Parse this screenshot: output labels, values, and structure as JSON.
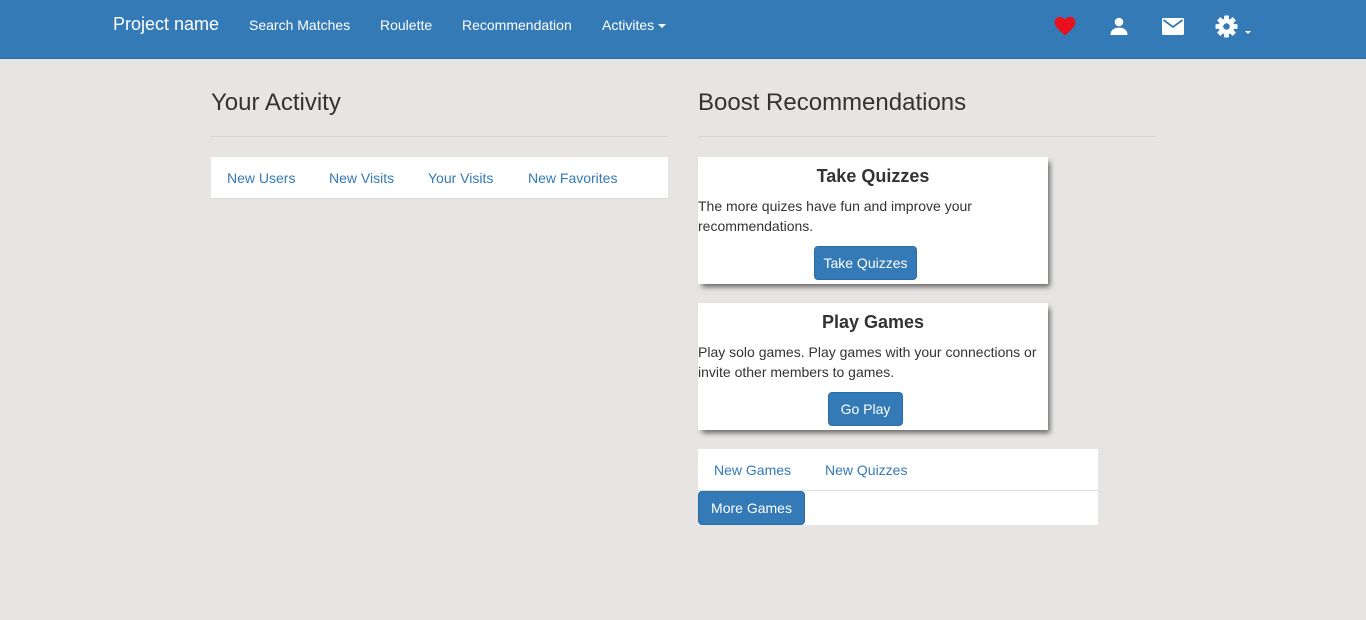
{
  "navbar": {
    "brand": "Project name",
    "links": [
      "Search Matches",
      "Roulette",
      "Recommendation",
      "Activites"
    ],
    "icons": [
      "heart-icon",
      "user-icon",
      "mail-icon",
      "gear-icon"
    ],
    "colors": {
      "bar": "#337ab7",
      "heart": "#e8101d"
    }
  },
  "activity": {
    "title": "Your Activity",
    "tabs": [
      "New Users",
      "New Visits",
      "Your Visits",
      "New Favorites"
    ]
  },
  "boost": {
    "title": "Boost Recommendations",
    "cards": [
      {
        "title": "Take Quizzes",
        "text": "The more quizes have fun and improve your recommendations.",
        "button": "Take Quizzes"
      },
      {
        "title": "Play Games",
        "text": "Play solo games. Play games with your connections or invite other members to games.",
        "button": "Go Play"
      }
    ],
    "games_tabs": [
      "New Games",
      "New Quizzes"
    ],
    "more_button": "More Games"
  }
}
